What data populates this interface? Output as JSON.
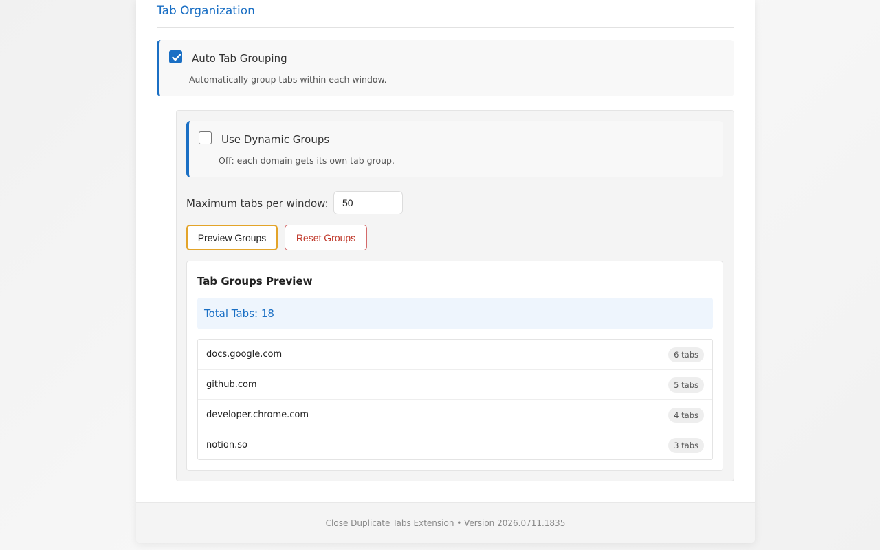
{
  "section": {
    "title": "Tab Organization"
  },
  "auto_grouping": {
    "label": "Auto Tab Grouping",
    "description": "Automatically group tabs within each window.",
    "checked": true
  },
  "dynamic_groups": {
    "label": "Use Dynamic Groups",
    "description": "Off: each domain gets its own tab group.",
    "checked": false
  },
  "max_tabs": {
    "label": "Maximum tabs per window:",
    "value": "50"
  },
  "buttons": {
    "preview": "Preview Groups",
    "reset": "Reset Groups"
  },
  "preview": {
    "title": "Tab Groups Preview",
    "total": "Total Tabs: 18",
    "groups": [
      {
        "domain": "docs.google.com",
        "count": "6 tabs"
      },
      {
        "domain": "github.com",
        "count": "5 tabs"
      },
      {
        "domain": "developer.chrome.com",
        "count": "4 tabs"
      },
      {
        "domain": "notion.so",
        "count": "3 tabs"
      }
    ]
  },
  "footer": {
    "text": "Close Duplicate Tabs Extension • Version 2026.0711.1835"
  },
  "colors": {
    "accent": "#1a6fc4",
    "preview_button_border": "#e3a42a",
    "reset_button": "#c0392b"
  }
}
